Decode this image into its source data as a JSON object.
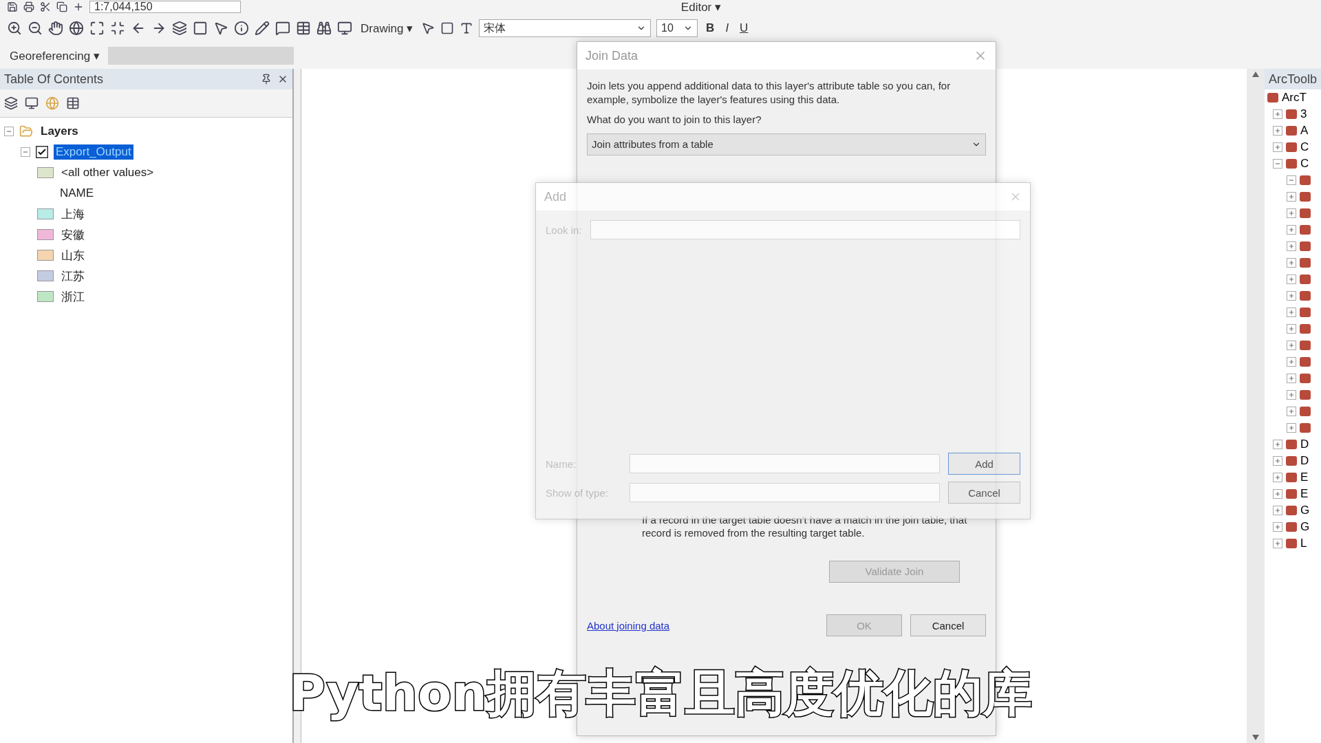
{
  "toolbar_top": {
    "scale": "1:7,044,150",
    "editor": "Editor ▾"
  },
  "toolbar_main": {
    "drawing": "Drawing ▾",
    "font": "宋体",
    "font_size": "10",
    "bold": "B",
    "italic": "I",
    "underline": "U"
  },
  "georeferencing": {
    "label": "Georeferencing ▾"
  },
  "toc": {
    "title": "Table Of Contents",
    "tree": [
      {
        "label": "Layers",
        "expanded": true,
        "children": [
          {
            "label": "Export_Output",
            "checked": true,
            "selected": true,
            "expanded": true,
            "children": [
              {
                "kind": "symbol",
                "label": "<all other values>",
                "color": "#dde6cc"
              },
              {
                "kind": "heading",
                "label": "NAME"
              },
              {
                "kind": "symbol",
                "label": "上海",
                "color": "#b8ece6"
              },
              {
                "kind": "symbol",
                "label": "安徽",
                "color": "#f0b8d8"
              },
              {
                "kind": "symbol",
                "label": "山东",
                "color": "#f5d4b0"
              },
              {
                "kind": "symbol",
                "label": "江苏",
                "color": "#c4cce4"
              },
              {
                "kind": "symbol",
                "label": "浙江",
                "color": "#bfe6c4"
              }
            ]
          }
        ]
      }
    ]
  },
  "join_dialog": {
    "title": "Join Data",
    "intro": "Join lets you append additional data to this layer's attribute table so you can, for example, symbolize the layer's features using this data.",
    "question": "What do you want to join to this layer?",
    "join_type": "Join attributes from a table",
    "option_note": "If a record in the target table doesn't have a match in the join table, that record is removed from the resulting target table.",
    "validate_button": "Validate Join",
    "help_link": "About joining data",
    "buttons": [
      {
        "label": "OK",
        "disabled": true
      },
      {
        "label": "Cancel",
        "disabled": false
      }
    ]
  },
  "add_dialog": {
    "title": "Add",
    "look_in_label": "Look in:",
    "name_label": "Name:",
    "type_label": "Show of type:",
    "buttons": [
      {
        "label": "Add",
        "selected": true
      },
      {
        "label": "Cancel",
        "selected": false
      }
    ]
  },
  "toolbox": {
    "title": "ArcToolb",
    "root": "ArcT",
    "items": [
      {
        "label": "3",
        "expanded": false
      },
      {
        "label": "A",
        "expanded": false
      },
      {
        "label": "C",
        "expanded": false
      },
      {
        "label": "C",
        "expanded": true
      },
      {
        "label": "D",
        "expanded": false
      },
      {
        "label": "D",
        "expanded": false
      },
      {
        "label": "E",
        "expanded": false
      },
      {
        "label": "E",
        "expanded": false
      },
      {
        "label": "G",
        "expanded": false
      },
      {
        "label": "G",
        "expanded": false
      },
      {
        "label": "L",
        "expanded": false
      }
    ]
  },
  "subtitle": "Python拥有丰富且高度优化的库"
}
